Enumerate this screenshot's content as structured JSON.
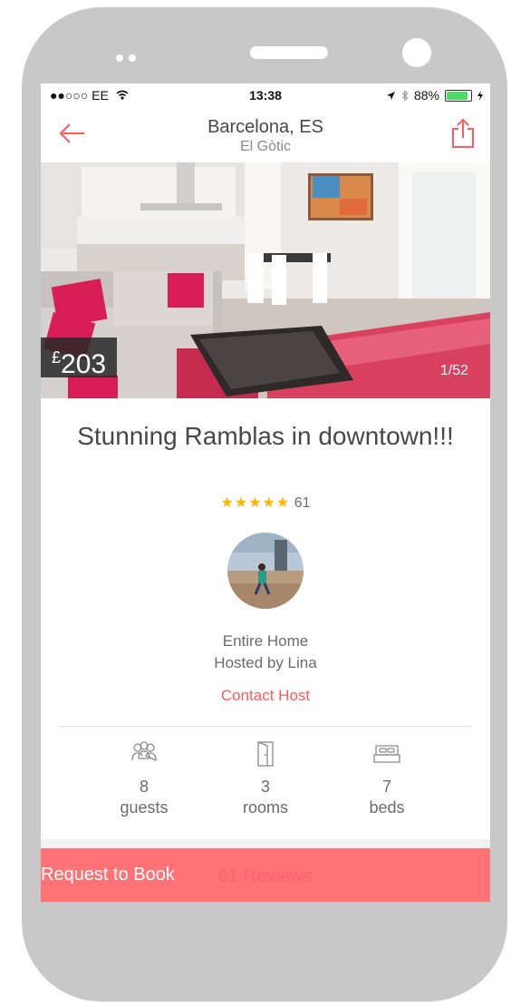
{
  "status_bar": {
    "carrier": "●●○○○ EE",
    "time": "13:38",
    "battery": "88%"
  },
  "nav": {
    "title": "Barcelona, ES",
    "subtitle": "El Gòtic",
    "back_icon": "arrow-left-icon",
    "share_icon": "share-icon"
  },
  "hero": {
    "price_currency": "£",
    "price_amount": "203",
    "photo_counter": "1/52"
  },
  "listing": {
    "title": "Stunning Ramblas in downtown!!!",
    "stars": "★★★★★",
    "star_rating": 5,
    "review_count": "61",
    "room_type": "Entire Home",
    "host": "Hosted by Lina",
    "contact_label": "Contact Host"
  },
  "amenities": [
    {
      "icon": "guests-icon",
      "value": "8",
      "label": "guests"
    },
    {
      "icon": "door-icon",
      "value": "3",
      "label": "rooms"
    },
    {
      "icon": "bed-icon",
      "value": "7",
      "label": "beds"
    }
  ],
  "footer": {
    "book_label": "Request to Book",
    "reviews_label": "61 Reviews"
  },
  "colors": {
    "accent": "#ff5a5f",
    "book_bar": "#ff7377",
    "star": "#ffb400",
    "phone_body": "#c8c8c9"
  }
}
